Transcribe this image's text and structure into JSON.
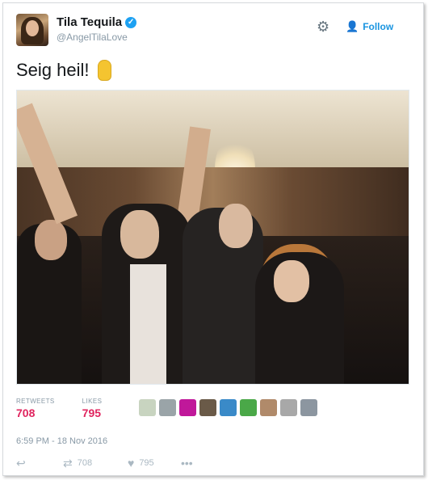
{
  "author": {
    "name": "Tila Tequila",
    "handle": "@AngelTilaLove"
  },
  "follow": {
    "label": "Follow"
  },
  "tweet": {
    "text": "Seig heil!"
  },
  "stats": {
    "retweets_label": "RETWEETS",
    "retweets_value": "708",
    "likes_label": "LIKES",
    "likes_value": "795"
  },
  "likers": [
    {
      "color": "#c8d4c0"
    },
    {
      "color": "#9aa4a8"
    },
    {
      "color": "#c0189a"
    },
    {
      "color": "#6a5a48"
    },
    {
      "color": "#3a8ac8"
    },
    {
      "color": "#4aa848"
    },
    {
      "color": "#b08a6a"
    },
    {
      "color": "#a8a8a8"
    },
    {
      "color": "#8c96a0"
    }
  ],
  "timestamp": "6:59 PM - 18 Nov 2016",
  "actions": {
    "retweet_count": "708",
    "like_count": "795"
  },
  "colors": {
    "accent": "#1b95e0",
    "likes": "#e0245e"
  }
}
